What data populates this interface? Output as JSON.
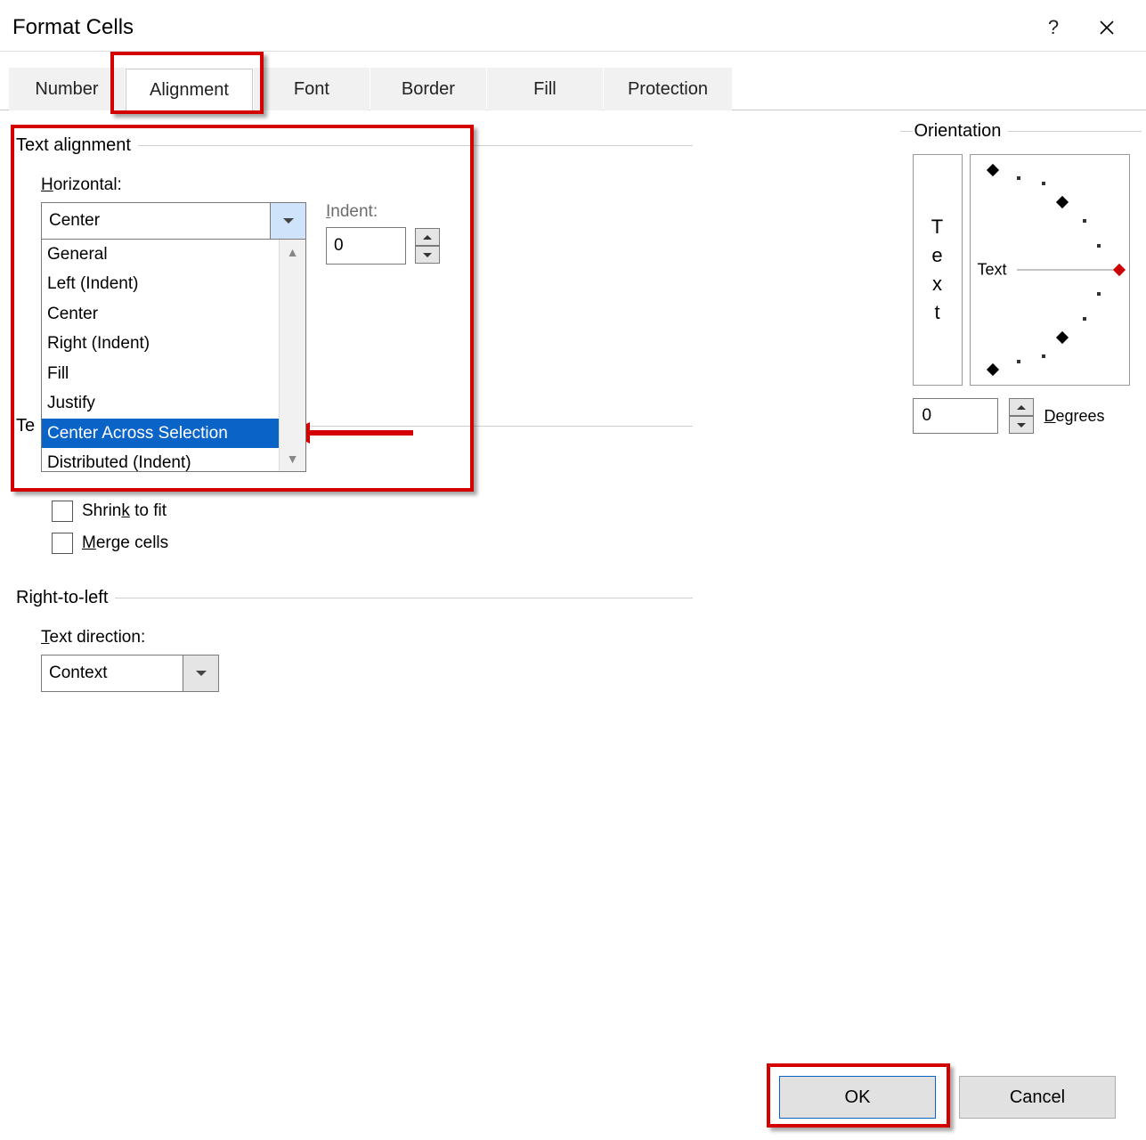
{
  "title": "Format Cells",
  "tabs": [
    "Number",
    "Alignment",
    "Font",
    "Border",
    "Fill",
    "Protection"
  ],
  "active_tab_index": 1,
  "alignment": {
    "group_label": "Text alignment",
    "horizontal_label": "Horizontal:",
    "horizontal_value": "Center",
    "horizontal_options": [
      "General",
      "Left (Indent)",
      "Center",
      "Right (Indent)",
      "Fill",
      "Justify",
      "Center Across Selection",
      "Distributed (Indent)"
    ],
    "horizontal_highlight_index": 6,
    "indent_label": "Indent:",
    "indent_value": "0"
  },
  "text_control": {
    "group_label": "Te",
    "shrink_label": "Shrink to fit",
    "merge_label": "Merge cells"
  },
  "rtl": {
    "group_label": "Right-to-left",
    "direction_label": "Text direction:",
    "direction_value": "Context"
  },
  "orientation": {
    "group_label": "Orientation",
    "vertical_text": [
      "T",
      "e",
      "x",
      "t"
    ],
    "needle_label": "Text",
    "degrees_value": "0",
    "degrees_label": "Degrees"
  },
  "buttons": {
    "ok": "OK",
    "cancel": "Cancel"
  }
}
